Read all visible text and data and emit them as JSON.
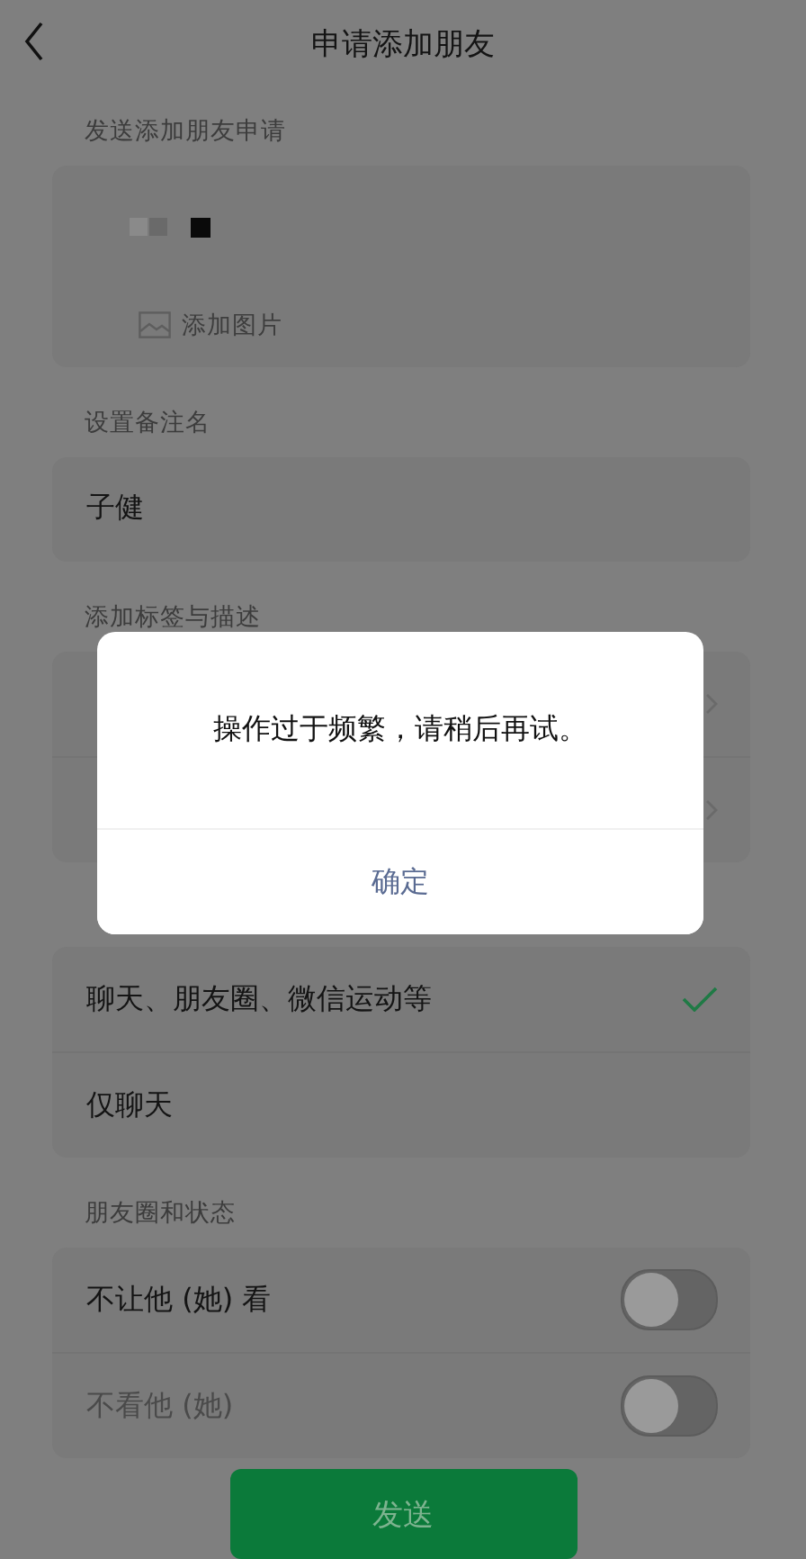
{
  "header": {
    "title": "申请添加朋友"
  },
  "request": {
    "label": "发送添加朋友申请",
    "add_image": "添加图片"
  },
  "remark": {
    "label": "设置备注名",
    "value": "子健"
  },
  "tags": {
    "label": "添加标签与描述"
  },
  "permissions": {
    "options": [
      {
        "label": "聊天、朋友圈、微信运动等",
        "selected": true
      },
      {
        "label": "仅聊天",
        "selected": false
      }
    ]
  },
  "moments": {
    "label": "朋友圈和状态",
    "toggles": [
      {
        "label": "不让他 (她) 看",
        "on": false,
        "disabled": false
      },
      {
        "label": "不看他 (她)",
        "on": false,
        "disabled": true
      }
    ]
  },
  "send_button": "发送",
  "dialog": {
    "message": "操作过于频繁，请稍后再试。",
    "button": "确定"
  }
}
